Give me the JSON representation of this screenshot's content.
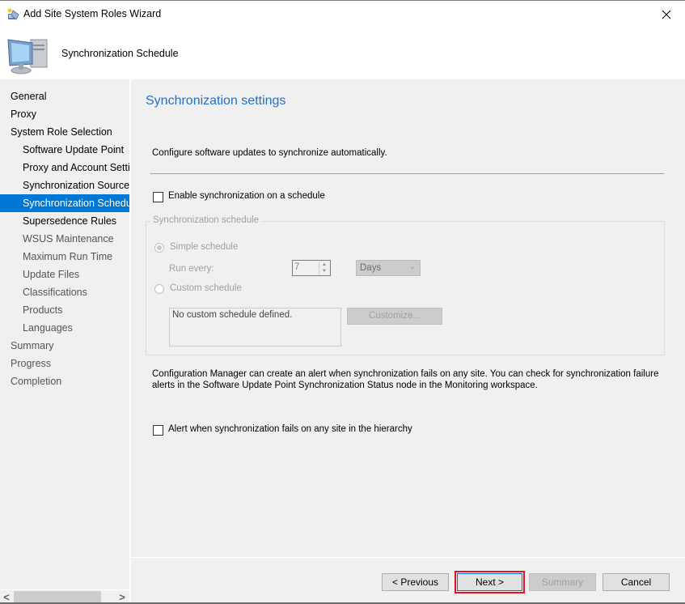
{
  "window": {
    "title": "Add Site System Roles Wizard",
    "close_icon": "close-icon"
  },
  "header": {
    "title": "Synchronization Schedule",
    "icon": "computer-icon"
  },
  "nav": {
    "items": [
      {
        "label": "General",
        "level": 0,
        "selected": false,
        "disabled": false
      },
      {
        "label": "Proxy",
        "level": 0,
        "selected": false,
        "disabled": false
      },
      {
        "label": "System Role Selection",
        "level": 0,
        "selected": false,
        "disabled": false
      },
      {
        "label": "Software Update Point",
        "level": 1,
        "selected": false,
        "disabled": false
      },
      {
        "label": "Proxy and Account Settings",
        "level": 1,
        "selected": false,
        "disabled": false
      },
      {
        "label": "Synchronization Source",
        "level": 1,
        "selected": false,
        "disabled": false
      },
      {
        "label": "Synchronization Schedule",
        "level": 1,
        "selected": true,
        "disabled": false
      },
      {
        "label": "Supersedence Rules",
        "level": 1,
        "selected": false,
        "disabled": false
      },
      {
        "label": "WSUS Maintenance",
        "level": 1,
        "selected": false,
        "disabled": true
      },
      {
        "label": "Maximum Run Time",
        "level": 1,
        "selected": false,
        "disabled": true
      },
      {
        "label": "Update Files",
        "level": 1,
        "selected": false,
        "disabled": true
      },
      {
        "label": "Classifications",
        "level": 1,
        "selected": false,
        "disabled": true
      },
      {
        "label": "Products",
        "level": 1,
        "selected": false,
        "disabled": true
      },
      {
        "label": "Languages",
        "level": 1,
        "selected": false,
        "disabled": true
      },
      {
        "label": "Summary",
        "level": 0,
        "selected": false,
        "disabled": true
      },
      {
        "label": "Progress",
        "level": 0,
        "selected": false,
        "disabled": true
      },
      {
        "label": "Completion",
        "level": 0,
        "selected": false,
        "disabled": true
      }
    ],
    "scroll_left": "<",
    "scroll_right": ">"
  },
  "main": {
    "section_title": "Synchronization settings",
    "description": "Configure software updates to synchronize automatically.",
    "enable_schedule": {
      "label": "Enable synchronization on a schedule",
      "checked": false
    },
    "schedule_group": {
      "legend": "Synchronization schedule",
      "simple_schedule_label": "Simple schedule",
      "simple_selected": true,
      "run_every_label": "Run every:",
      "run_every_value": "7",
      "unit_value": "Days",
      "custom_schedule_label": "Custom schedule",
      "custom_text": "No custom schedule defined.",
      "customize_label": "Customize..."
    },
    "alert_info": "Configuration Manager can create an alert when synchronization fails on any site. You can check for synchronization failure alerts in the Software Update Point Synchronization Status node in the Monitoring workspace.",
    "alert_checkbox": {
      "label": "Alert when synchronization fails on any site in the hierarchy",
      "checked": false
    }
  },
  "buttons": {
    "previous": "< Previous",
    "next": "Next >",
    "summary": "Summary",
    "cancel": "Cancel"
  },
  "colors": {
    "accent": "#0078d7",
    "title_blue": "#1e73c8",
    "highlight_red": "#e81123"
  }
}
